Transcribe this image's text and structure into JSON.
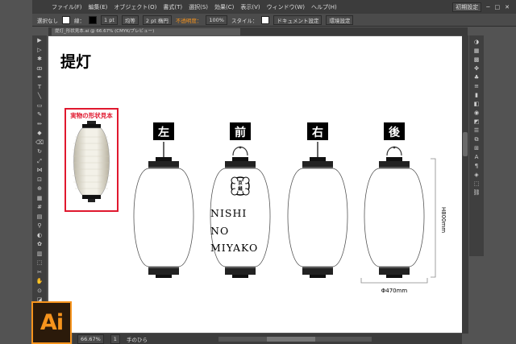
{
  "app": {
    "logo_small": "Ai",
    "menus": [
      "ファイル(F)",
      "編集(E)",
      "オブジェクト(O)",
      "書式(T)",
      "選択(S)",
      "効果(C)",
      "表示(V)",
      "ウィンドウ(W)",
      "ヘルプ(H)"
    ],
    "workspace": "初期設定"
  },
  "controlbar": {
    "selection": "選択なし",
    "stroke_label": "線：",
    "stroke_width": "1 pt",
    "line_style": "均等",
    "brush": "2 pt 楕円",
    "opacity_label": "不透明度：",
    "opacity": "100%",
    "style_label": "スタイル：",
    "doc_settings": "ドキュメント設定",
    "env_settings": "環境設定"
  },
  "tab": {
    "filename": "提灯_形状見本.ai @ 66.67% (CMYK/プレビュー)"
  },
  "statusbar": {
    "zoom": "66.67%",
    "page": "1",
    "tool": "手のひら"
  },
  "document": {
    "title": "提灯",
    "sample_label": "実物の形状見本",
    "views": [
      "左",
      "前",
      "右",
      "後"
    ],
    "front_text": [
      "NISHI",
      "NO",
      "MIYAKO"
    ],
    "crest_text": "京\n縫",
    "height_dim": "H800mm",
    "width_dim": "Φ470mm"
  },
  "badge": "Ai",
  "colors": {
    "accent": "#f7941d",
    "red": "#e0182e",
    "ui_bg": "#535353"
  }
}
